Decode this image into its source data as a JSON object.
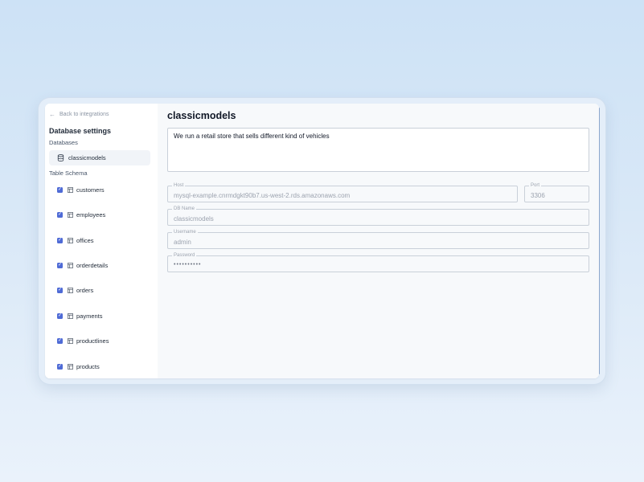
{
  "sidebar": {
    "back_label": "Back to integrations",
    "heading": "Database settings",
    "databases_label": "Databases",
    "database_item": "classicmodels",
    "schema_label": "Table Schema",
    "tables": [
      {
        "label": "customers",
        "checked": true
      },
      {
        "label": "employees",
        "checked": true
      },
      {
        "label": "offices",
        "checked": true
      },
      {
        "label": "orderdetails",
        "checked": true
      },
      {
        "label": "orders",
        "checked": true
      },
      {
        "label": "payments",
        "checked": true
      },
      {
        "label": "productlines",
        "checked": true
      },
      {
        "label": "products",
        "checked": true
      }
    ]
  },
  "main": {
    "title": "classicmodels",
    "description": "We run a retail store that sells different kind of vehicles",
    "host": {
      "label": "Host",
      "value": "mysql-example.cnrmdgkt90b7.us-west-2.rds.amazonaws.com"
    },
    "port": {
      "label": "Port",
      "value": "3306"
    },
    "db_name": {
      "label": "DB Name",
      "value": "classicmodels"
    },
    "username": {
      "label": "Username",
      "value": "admin"
    },
    "password": {
      "label": "Password",
      "value": "••••••••••"
    }
  },
  "colors": {
    "accent": "#4f6bd6",
    "background_top": "#cde2f6",
    "main_bg": "#f7f9fb"
  },
  "icons": {
    "back": "arrow-left-icon",
    "database": "database-icon",
    "table": "table-icon",
    "checkbox": "check-icon"
  }
}
